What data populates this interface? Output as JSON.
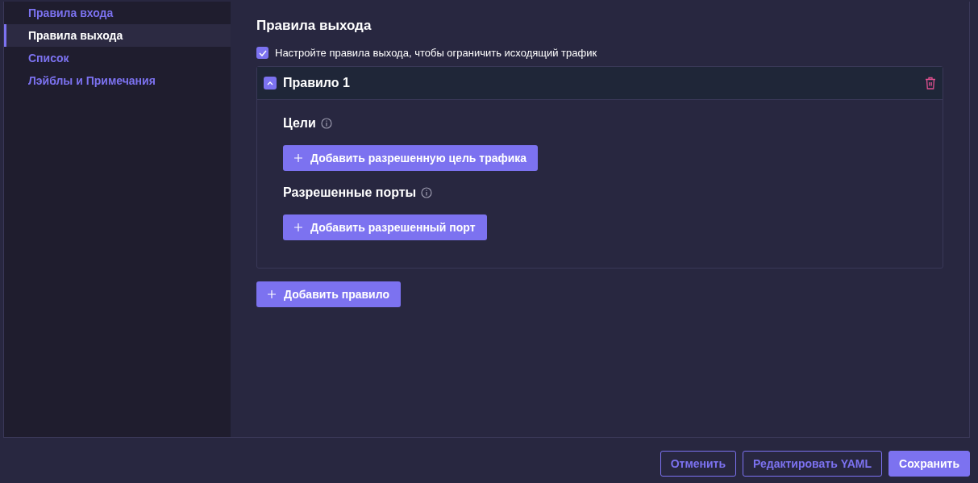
{
  "sidebar": {
    "items": [
      {
        "label": "Правила входа",
        "selected": false
      },
      {
        "label": "Правила выхода",
        "selected": true
      },
      {
        "label": "Список",
        "selected": false
      },
      {
        "label": "Лэйблы и Примечания",
        "selected": false
      }
    ]
  },
  "section_title": "Правила выхода",
  "egress_checkbox": {
    "label": "Настройте правила выхода, чтобы ограничить исходящий трафик",
    "checked": true
  },
  "rules": [
    {
      "title": "Правило 1",
      "expanded": true,
      "groups": [
        {
          "heading": "Цели",
          "button": "Добавить разрешенную цель трафика"
        },
        {
          "heading": "Разрешенные порты",
          "button": "Добавить разрешенный порт"
        }
      ]
    }
  ],
  "add_rule_button": "Добавить правило",
  "footer": {
    "buttons": [
      {
        "label": "Отменить",
        "kind": "outline"
      },
      {
        "label": "Редактировать YAML",
        "kind": "outline"
      },
      {
        "label": "Сохранить",
        "kind": "primary"
      }
    ]
  }
}
